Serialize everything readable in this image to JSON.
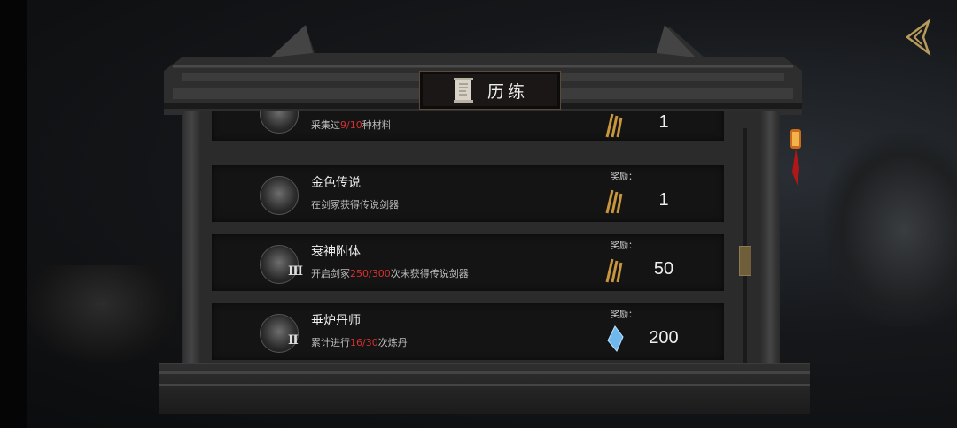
{
  "window": {
    "title": "历练"
  },
  "reward_label": "奖励：",
  "achievements": [
    {
      "name": "",
      "desc_parts": [
        "采集过",
        "9/10",
        "种材料"
      ],
      "reward_value": "1",
      "reward_type": "gold-tokens",
      "partial": "top"
    },
    {
      "name": "金色传说",
      "desc_parts": [
        "在剑冢获得传说剑器",
        "",
        ""
      ],
      "reward_value": "1",
      "reward_type": "gold-tokens",
      "level": ""
    },
    {
      "name": "衰神附体",
      "desc_parts": [
        "开启剑冢",
        "250/300",
        "次未获得传说剑器"
      ],
      "reward_value": "50",
      "reward_type": "gold-tokens",
      "level": "Ⅲ"
    },
    {
      "name": "垂炉丹师",
      "desc_parts": [
        "累计进行",
        "16/30",
        "次炼丹"
      ],
      "reward_value": "200",
      "reward_type": "blue-crystal",
      "level": "Ⅱ"
    }
  ],
  "colors": {
    "highlight": "#d63030",
    "frame": "#2b2b2b",
    "accent_gold": "#c8963c"
  },
  "icons": {
    "back": "back-arrow-icon",
    "title": "scroll-icon"
  }
}
